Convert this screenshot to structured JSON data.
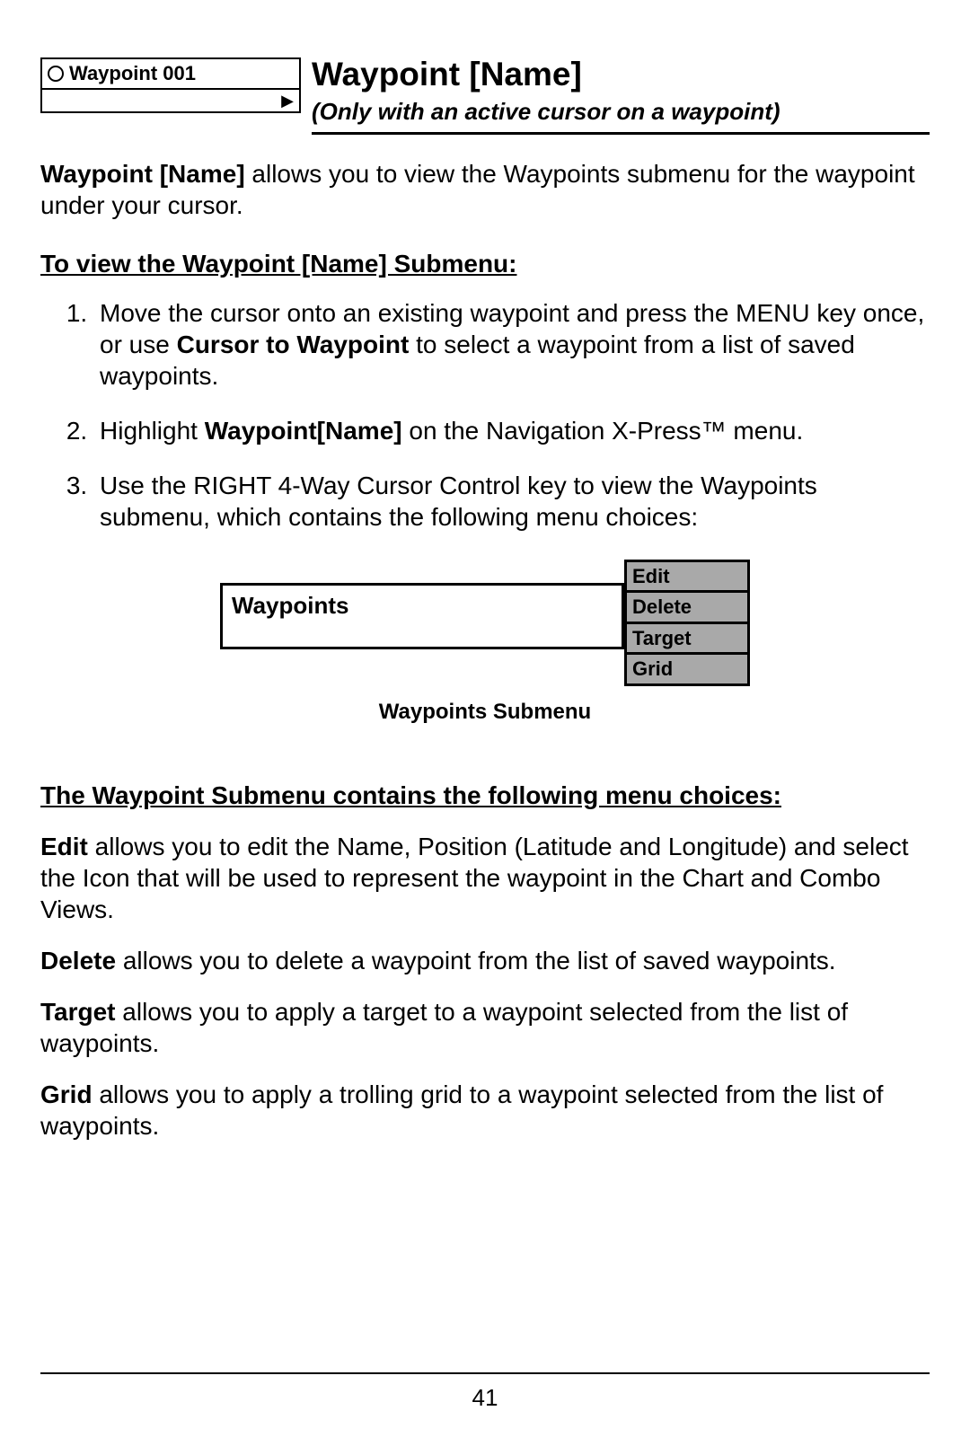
{
  "header": {
    "icon_label": "Waypoint 001",
    "title": "Waypoint [Name]",
    "subtitle": "(Only with an active cursor on a waypoint)"
  },
  "intro": {
    "lead": "Waypoint [Name]",
    "rest": " allows you to view the Waypoints submenu for the waypoint under your cursor."
  },
  "steps_heading": "To view the Waypoint [Name] Submenu:",
  "steps": {
    "s1a": "Move the cursor onto an existing waypoint and press the MENU key once, or use ",
    "s1b": "Cursor to Waypoint",
    "s1c": " to select a waypoint from a list of saved waypoints.",
    "s2a": "Highlight ",
    "s2b": "Waypoint[Name]",
    "s2c": " on the Navigation X-Press™ menu.",
    "s3": "Use the RIGHT 4-Way Cursor Control key to view the Waypoints submenu, which contains the following menu choices:"
  },
  "submenu": {
    "left_label": "Waypoints",
    "items": [
      "Edit",
      "Delete",
      "Target",
      "Grid"
    ],
    "caption": "Waypoints Submenu"
  },
  "defs_heading": "The Waypoint Submenu contains the following menu choices:",
  "defs": {
    "edit_lead": "Edit",
    "edit_rest": " allows you to edit the Name, Position (Latitude and Longitude) and select the Icon that will be used to represent the waypoint in the Chart and Combo Views.",
    "delete_lead": "Delete",
    "delete_rest": " allows you to delete a waypoint from the list of saved waypoints.",
    "target_lead": "Target",
    "target_rest": " allows you to apply a target to a waypoint selected from the list of waypoints.",
    "grid_lead": "Grid",
    "grid_rest": " allows you to apply a trolling grid to a waypoint selected from the list of waypoints."
  },
  "page_number": "41"
}
